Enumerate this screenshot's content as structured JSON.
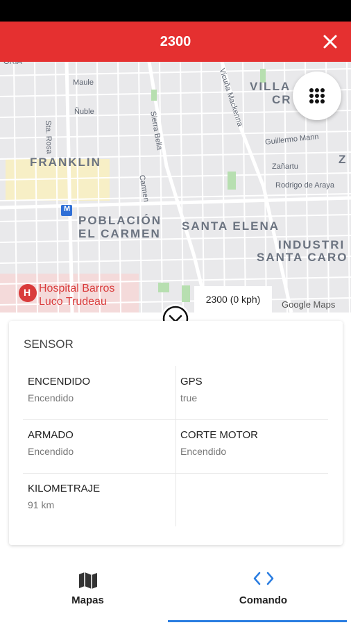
{
  "header": {
    "title": "2300",
    "close_icon": "close-icon"
  },
  "map": {
    "labels": {
      "franklin": "FRANKLIN",
      "poblacion_1": "POBLACIÓN",
      "poblacion_2": "EL CARMEN",
      "santa_elena": "SANTA ELENA",
      "villa": "VILLA",
      "villa_cr": "CR",
      "z": "Z",
      "industri": "INDUSTRI",
      "santa_caro": "SANTA CARO",
      "maule": "Maule",
      "nuble": "Ñuble",
      "sta_rosa": "Sta. Rosa",
      "sierra_bella": "Sierra Bella",
      "carmen": "Carmen",
      "vicuna": "Vicuña Mackenna",
      "guillermo": "Guillermo Mann",
      "zanartu": "Zañartu",
      "rodrigo": "Rodrigo de Araya",
      "hospital_1": "Hospital Barros",
      "hospital_2": "Luco Trudeau",
      "metro": "M"
    },
    "speed_label": "2300 (0 kph)",
    "google_attribution": "Google Maps",
    "colors": {
      "background": "#e9e9eb",
      "park": "#b7dfb0",
      "zone": "#f7efc6",
      "hospital": "#d93b3b"
    }
  },
  "sensor": {
    "title": "SENSOR",
    "items": [
      {
        "label": "ENCENDIDO",
        "value": "Encendido"
      },
      {
        "label": "GPS",
        "value": "true"
      },
      {
        "label": "ARMADO",
        "value": "Encendido"
      },
      {
        "label": "CORTE MOTOR",
        "value": "Encendido"
      },
      {
        "label": "KILOMETRAJE",
        "value": "91 km"
      }
    ]
  },
  "bottom_nav": {
    "tabs": [
      {
        "label": "Mapas",
        "icon": "map-icon",
        "active": false
      },
      {
        "label": "Comando",
        "icon": "code-icon",
        "active": true
      }
    ],
    "accent_color": "#2a7de1"
  },
  "header_color": "#e53030"
}
